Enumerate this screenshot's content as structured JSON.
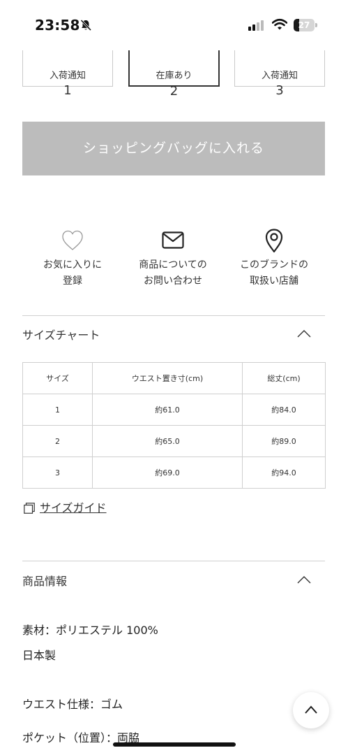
{
  "status_bar": {
    "time": "23:58",
    "battery_level": "27",
    "battery_fraction": 0.27,
    "icons": [
      "bell-slash-icon",
      "cellular-signal-icon",
      "wifi-icon",
      "battery-icon"
    ]
  },
  "size_options": [
    {
      "number": "1",
      "status": "入荷通知",
      "selected": false
    },
    {
      "number": "2",
      "status": "在庫あり",
      "selected": true
    },
    {
      "number": "3",
      "status": "入荷通知",
      "selected": false
    }
  ],
  "add_to_bag_label": "ショッピングバッグに入れる",
  "actions": [
    {
      "icon": "heart-icon",
      "line1": "お気に入りに",
      "line2": "登録"
    },
    {
      "icon": "envelope-icon",
      "line1": "商品についての",
      "line2": "お問い合わせ"
    },
    {
      "icon": "map-pin-icon",
      "line1": "このブランドの",
      "line2": "取扱い店舗"
    }
  ],
  "size_chart": {
    "title": "サイズチャート",
    "headers": [
      "サイズ",
      "ウエスト置き寸(cm)",
      "総丈(cm)"
    ],
    "rows": [
      [
        "1",
        "約61.0",
        "約84.0"
      ],
      [
        "2",
        "約65.0",
        "約89.0"
      ],
      [
        "3",
        "約69.0",
        "約94.0"
      ]
    ],
    "guide_link": "サイズガイド"
  },
  "product_info": {
    "title": "商品情報",
    "lines": [
      "素材：ポリエステル 100%",
      "日本製",
      "ウエスト仕様：ゴム",
      "ポケット（位置）：両脇"
    ]
  },
  "colors": {
    "bag_button": "#bcbcbc",
    "divider": "#cfcfcf",
    "text": "#333333"
  }
}
